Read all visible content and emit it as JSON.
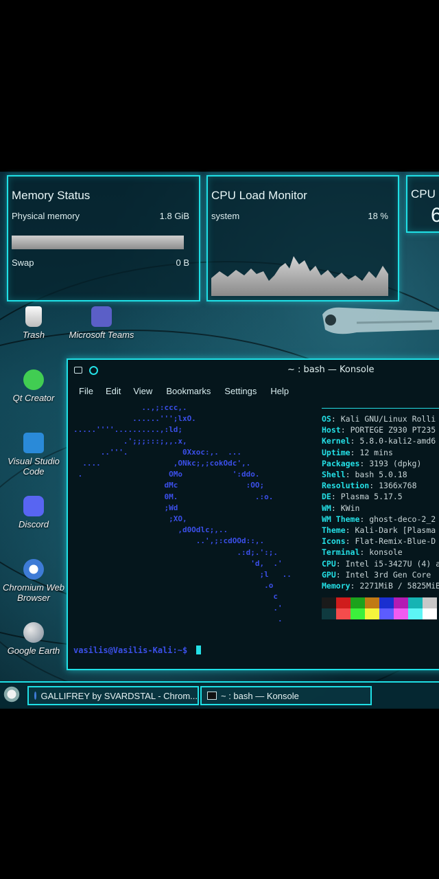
{
  "widgets": {
    "memory": {
      "title": "Memory Status",
      "physical_label": "Physical memory",
      "physical_value": "1.8 GiB",
      "physical_fill": 0.97,
      "swap_label": "Swap",
      "swap_value": "0 B"
    },
    "cpu_load": {
      "title": "CPU Load Monitor",
      "system_label": "system",
      "system_value": "18 %"
    },
    "cpu_partial": {
      "title": "CPU",
      "value": "6"
    }
  },
  "desktop_icons": [
    {
      "label": "Trash",
      "icon": "trash-icon"
    },
    {
      "label": "Microsoft Teams",
      "icon": "teams-icon"
    },
    {
      "label": "Qt Creator",
      "icon": "qt-creator-icon"
    },
    {
      "label": "Visual Studio Code",
      "icon": "vscode-icon"
    },
    {
      "label": "Discord",
      "icon": "discord-icon"
    },
    {
      "label": "Chromium Web Browser",
      "icon": "chromium-icon"
    },
    {
      "label": "Google Earth",
      "icon": "google-earth-icon"
    }
  ],
  "konsole": {
    "title": "~ : bash — Konsole",
    "menu": [
      "File",
      "Edit",
      "View",
      "Bookmarks",
      "Settings",
      "Help"
    ],
    "art_lines": [
      "               ..,;:ccc,.",
      "             ......''';lxO.",
      ".....''''..........,:ld;",
      "           .';;;:::;,,.x,",
      "      ..'''.            0Xxoc:,.  ...",
      "  ....                ,ONkc;,;cokOdc',.",
      " .                   OMo           ':ddo.",
      "                    dMc               :OO;",
      "                    0M.                 .:o.",
      "                    ;Wd",
      "                     ;XO,",
      "                       ,d0Odlc;,..",
      "                           ..',;:cdOOd::,.",
      "                                    .:d;.':;.",
      "                                       'd,  .'",
      "                                         ;l   ..",
      "                                          .o",
      "                                            c",
      "                                            .'",
      "                                             ."
    ],
    "info": [
      {
        "key": "OS",
        "value": "Kali GNU/Linux Rolli"
      },
      {
        "key": "Host",
        "value": "PORTEGE Z930 PT235"
      },
      {
        "key": "Kernel",
        "value": "5.8.0-kali2-amd6"
      },
      {
        "key": "Uptime",
        "value": "12 mins"
      },
      {
        "key": "Packages",
        "value": "3193 (dpkg)"
      },
      {
        "key": "Shell",
        "value": "bash 5.0.18"
      },
      {
        "key": "Resolution",
        "value": "1366x768"
      },
      {
        "key": "DE",
        "value": "Plasma 5.17.5"
      },
      {
        "key": "WM",
        "value": "KWin"
      },
      {
        "key": "WM Theme",
        "value": "ghost-deco-2_2"
      },
      {
        "key": "Theme",
        "value": "Kali-Dark [Plasma"
      },
      {
        "key": "Icons",
        "value": "Flat-Remix-Blue-D"
      },
      {
        "key": "Terminal",
        "value": "konsole"
      },
      {
        "key": "CPU",
        "value": "Intel i5-3427U (4) a"
      },
      {
        "key": "GPU",
        "value": "Intel 3rd Gen Core"
      },
      {
        "key": "Memory",
        "value": "2271MiB / 5825MiB"
      }
    ],
    "palette_top": [
      "#1a1a1a",
      "#d01c1c",
      "#1ca21c",
      "#c07a14",
      "#1a2fd0",
      "#b31cb3",
      "#16b4b4",
      "#c8c8c8"
    ],
    "palette_bottom": [
      "#0f3a3f",
      "#f44c4c",
      "#3cf03c",
      "#f5f53c",
      "#5c5cff",
      "#f05cf0",
      "#5cf5f5",
      "#ffffff"
    ],
    "prompt_user": "vasilis@Vasilis-Kali",
    "prompt_path": ":~$"
  },
  "taskbar": {
    "tasks": [
      {
        "label": "GALLIFREY by SVARDSTAL - Chrom...",
        "icon": "chromium-icon"
      },
      {
        "label": "~ : bash — Konsole",
        "icon": "terminal-icon"
      }
    ]
  },
  "colors": {
    "accent": "#1fe0e6",
    "terminal_bg": "#05161c",
    "art_blue": "#3b4fe8",
    "info_key": "#24e0e6"
  }
}
